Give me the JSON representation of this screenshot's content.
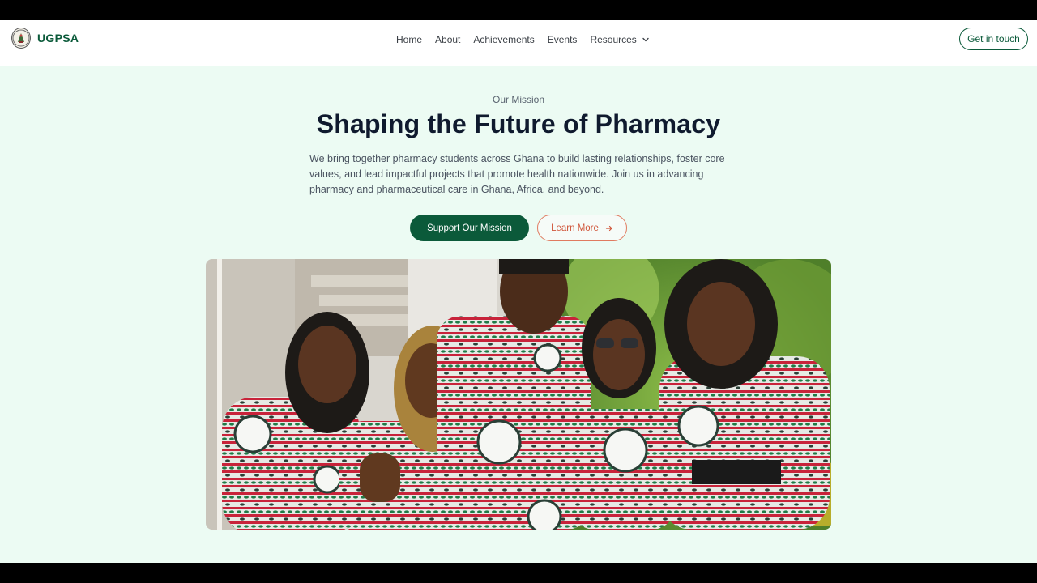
{
  "brand": {
    "name": "UGPSA",
    "logo_icon": "ugpsa-crest-icon"
  },
  "nav": {
    "links": [
      "Home",
      "About",
      "Achievements",
      "Events"
    ],
    "resources_label": "Resources",
    "resources_icon": "chevron-down-icon",
    "cta_label": "Get in touch"
  },
  "hero": {
    "eyebrow": "Our Mission",
    "title": "Shaping the Future of Pharmacy",
    "body": "We bring together pharmacy students across Ghana to build lasting relationships, foster core values, and lead impactful projects that promote health nationwide. Join us in advancing pharmacy and pharmaceutical care in Ghana, Africa, and beyond.",
    "primary_button": "Support Our Mission",
    "secondary_button": "Learn More",
    "secondary_icon": "arrow-right-icon"
  },
  "colors": {
    "brand_green": "#0b5a3a",
    "accent_coral": "#d0553a",
    "page_bg": "#ecfbf3",
    "heading": "#0f1a2e"
  }
}
